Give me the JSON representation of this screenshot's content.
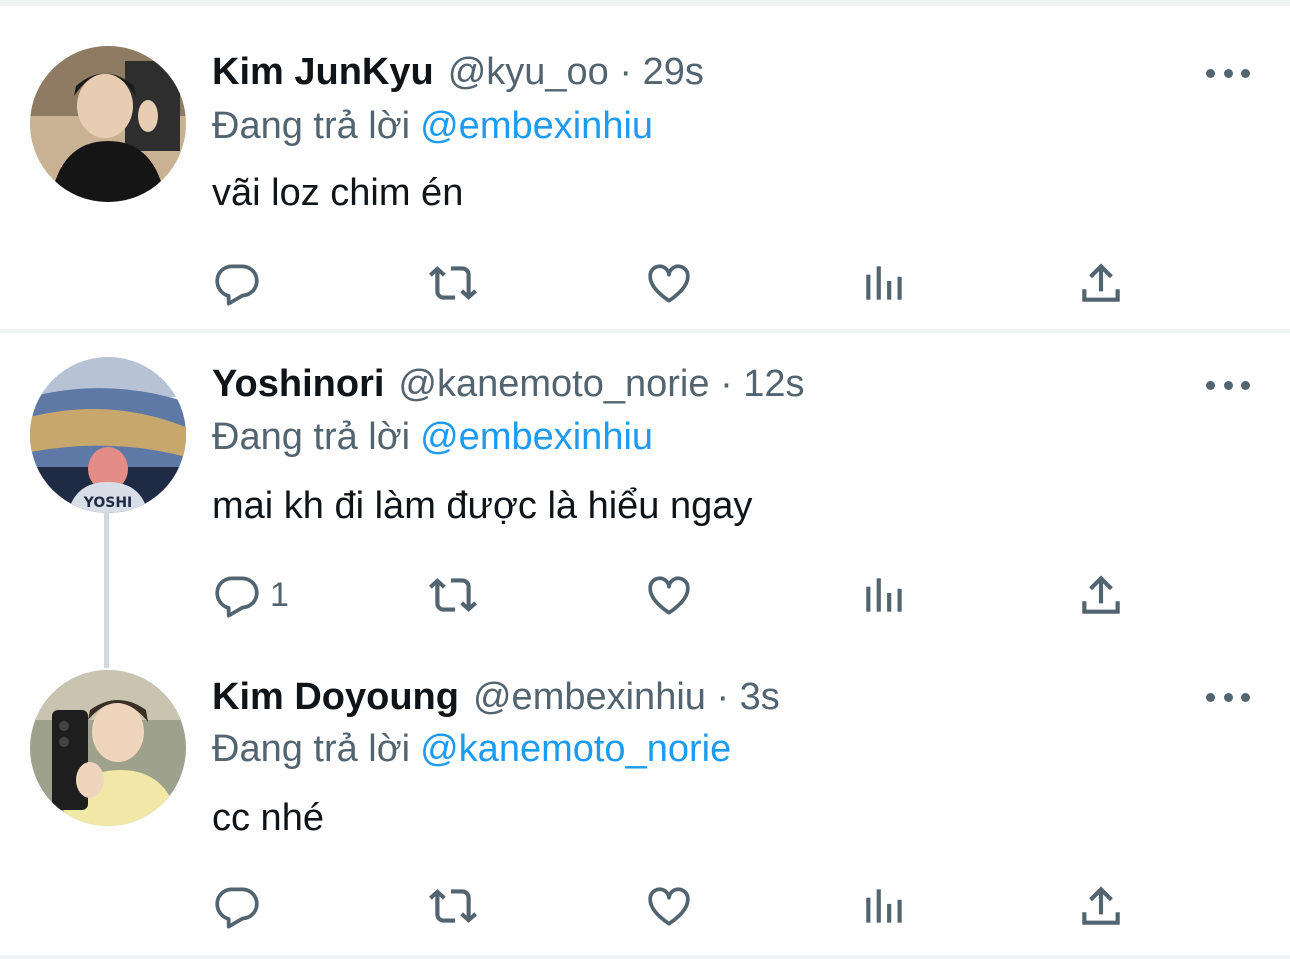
{
  "tweets": [
    {
      "name": "Kim JunKyu",
      "handle": "@kyu_oo",
      "time": "29s",
      "meta": "@kyu_oo · 29s",
      "reply_prefix": "Đang trả lời",
      "reply_to": "@embexinhiu",
      "text": "vãi loz chim én",
      "reply_count": "",
      "avatar_colors": [
        "#3a3a3a",
        "#d9c4a8",
        "#1b1b1b"
      ]
    },
    {
      "name": "Yoshinori",
      "handle": "@kanemoto_norie",
      "time": "12s",
      "meta": "@kanemoto_norie · 12s",
      "reply_prefix": "Đang trả lời",
      "reply_to": "@embexinhiu",
      "text": "mai kh đi làm được là hiểu ngay",
      "reply_count": "1",
      "avatar_colors": [
        "#6d87b5",
        "#c9a56b",
        "#e7eef7"
      ]
    },
    {
      "name": "Kim Doyoung",
      "handle": "@embexinhiu",
      "time": "3s",
      "meta": "@embexinhiu · 3s",
      "reply_prefix": "Đang trả lời",
      "reply_to": "@kanemoto_norie",
      "text": "cc nhé",
      "reply_count": "",
      "avatar_colors": [
        "#8a8f7a",
        "#f1e8b0",
        "#2a2a2a"
      ]
    }
  ],
  "icons": {
    "reply": "reply-icon",
    "retweet": "retweet-icon",
    "like": "heart-icon",
    "views": "views-icon",
    "share": "share-icon",
    "more": "more-icon"
  },
  "colors": {
    "text": "#0f1419",
    "secondary": "#536471",
    "link": "#1d9bf0",
    "divider": "#eff3f4",
    "thread_line": "#cfd9de"
  }
}
